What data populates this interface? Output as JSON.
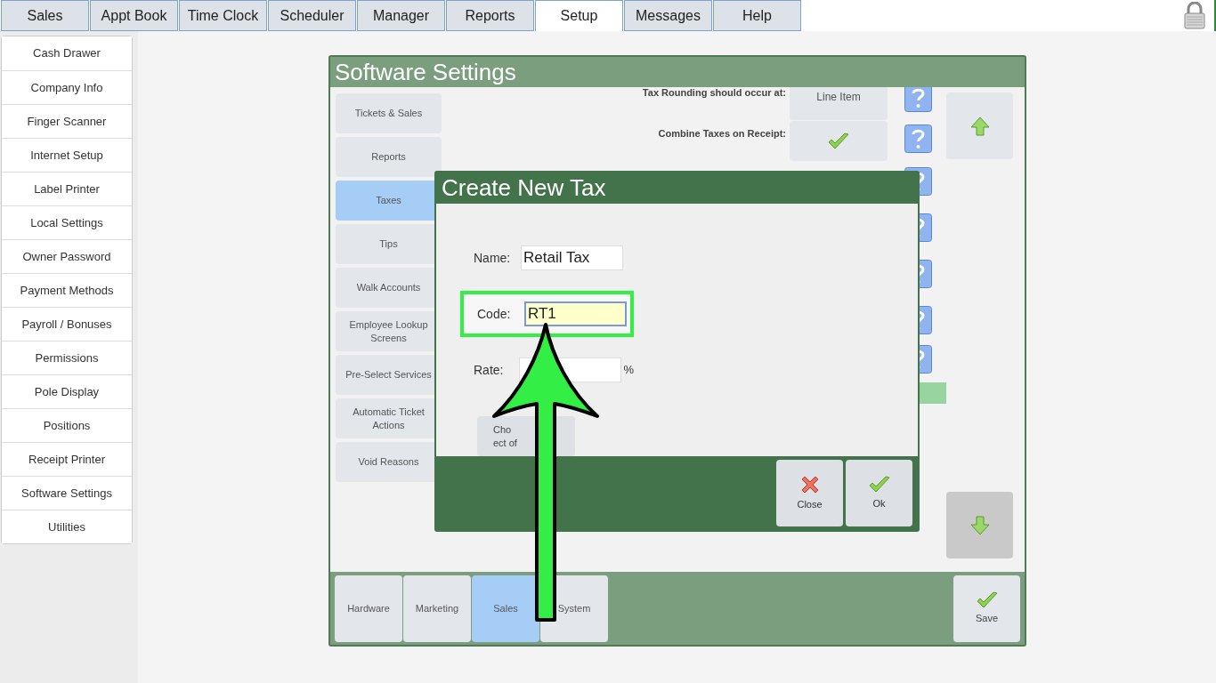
{
  "top_tabs": [
    {
      "label": "Sales",
      "selected": false
    },
    {
      "label": "Appt Book",
      "selected": false
    },
    {
      "label": "Time Clock",
      "selected": false
    },
    {
      "label": "Scheduler",
      "selected": false
    },
    {
      "label": "Manager",
      "selected": false
    },
    {
      "label": "Reports",
      "selected": false
    },
    {
      "label": "Setup",
      "selected": true
    },
    {
      "label": "Messages",
      "selected": false
    },
    {
      "label": "Help",
      "selected": false
    }
  ],
  "sidebar": {
    "items": [
      {
        "label": "Cash Drawer",
        "selected": false
      },
      {
        "label": "Company Info",
        "selected": false
      },
      {
        "label": "Finger Scanner",
        "selected": false
      },
      {
        "label": "Internet Setup",
        "selected": false
      },
      {
        "label": "Label Printer",
        "selected": false
      },
      {
        "label": "Local Settings",
        "selected": false
      },
      {
        "label": "Owner Password",
        "selected": false
      },
      {
        "label": "Payment Methods",
        "selected": false
      },
      {
        "label": "Payroll / Bonuses",
        "selected": false
      },
      {
        "label": "Permissions",
        "selected": false
      },
      {
        "label": "Pole Display",
        "selected": false
      },
      {
        "label": "Positions",
        "selected": false
      },
      {
        "label": "Receipt Printer",
        "selected": false
      },
      {
        "label": "Software Settings",
        "selected": false
      },
      {
        "label": "Utilities",
        "selected": false
      }
    ]
  },
  "settings_window": {
    "title": "Software Settings",
    "categories": [
      {
        "label": "Tickets & Sales",
        "selected": false
      },
      {
        "label": "Reports",
        "selected": false
      },
      {
        "label": "Taxes",
        "selected": true
      },
      {
        "label": "Tips",
        "selected": false
      },
      {
        "label": "Walk Accounts",
        "selected": false
      },
      {
        "label": "Employee Lookup Screens",
        "selected": false
      },
      {
        "label": "Pre-Select Services",
        "selected": false
      },
      {
        "label": "Automatic Ticket Actions",
        "selected": false
      },
      {
        "label": "Void Reasons",
        "selected": false
      }
    ],
    "settings": [
      {
        "kind": "choice",
        "label": "Tax Rounding should occur at:",
        "value": "Line Item"
      },
      {
        "kind": "toggle",
        "label": "Combine Taxes on Receipt:",
        "checked": true
      }
    ],
    "scroll_buttons": [
      {
        "kind": "up",
        "disabled": false
      },
      {
        "kind": "down",
        "disabled": true
      }
    ],
    "bottom_tabs": [
      {
        "label": "Hardware",
        "selected": false
      },
      {
        "label": "Marketing",
        "selected": false
      },
      {
        "label": "Sales",
        "selected": true
      },
      {
        "label": "System",
        "selected": false
      }
    ],
    "save_button": "Save"
  },
  "dialog": {
    "title": "Create New Tax",
    "fields": [
      {
        "label": "Name:",
        "value": "Retail Tax",
        "focused": false
      },
      {
        "label": "Code:",
        "value": "RT1",
        "focused": true
      },
      {
        "label": "Rate:",
        "suffix": "%",
        "focused": false
      }
    ],
    "partial_button": [
      "Cho",
      "ect of"
    ],
    "buttons": [
      {
        "kind": "close",
        "label": "Close"
      },
      {
        "kind": "ok",
        "label": "Ok"
      }
    ]
  }
}
